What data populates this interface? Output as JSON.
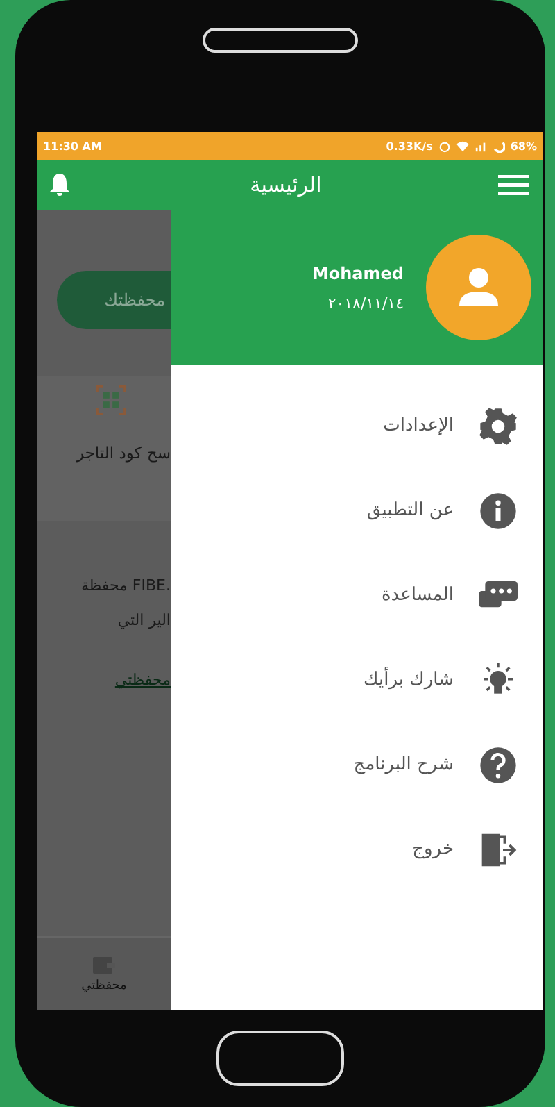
{
  "status_bar": {
    "time": "11:30 AM",
    "speed": "0.33K/s",
    "battery": "68%"
  },
  "app_bar": {
    "title": "الرئيسية"
  },
  "background": {
    "button": "محفظتك",
    "scan_label": "سح كود التاجر",
    "text_lines": [
      "محفظة FIBE.",
      "الير التي"
    ],
    "link": "محفظتي",
    "nav_label": "محفظتي"
  },
  "drawer": {
    "user_name": "Mohamed",
    "date": "٢٠١٨/١١/١٤",
    "items": [
      {
        "label": "الإعدادات",
        "kind": "settings"
      },
      {
        "label": "عن التطبيق",
        "kind": "info"
      },
      {
        "label": "المساعدة",
        "kind": "help-chat"
      },
      {
        "label": "شارك برأيك",
        "kind": "idea"
      },
      {
        "label": "شرح البرنامج",
        "kind": "question"
      },
      {
        "label": "خروج",
        "kind": "exit"
      }
    ]
  }
}
